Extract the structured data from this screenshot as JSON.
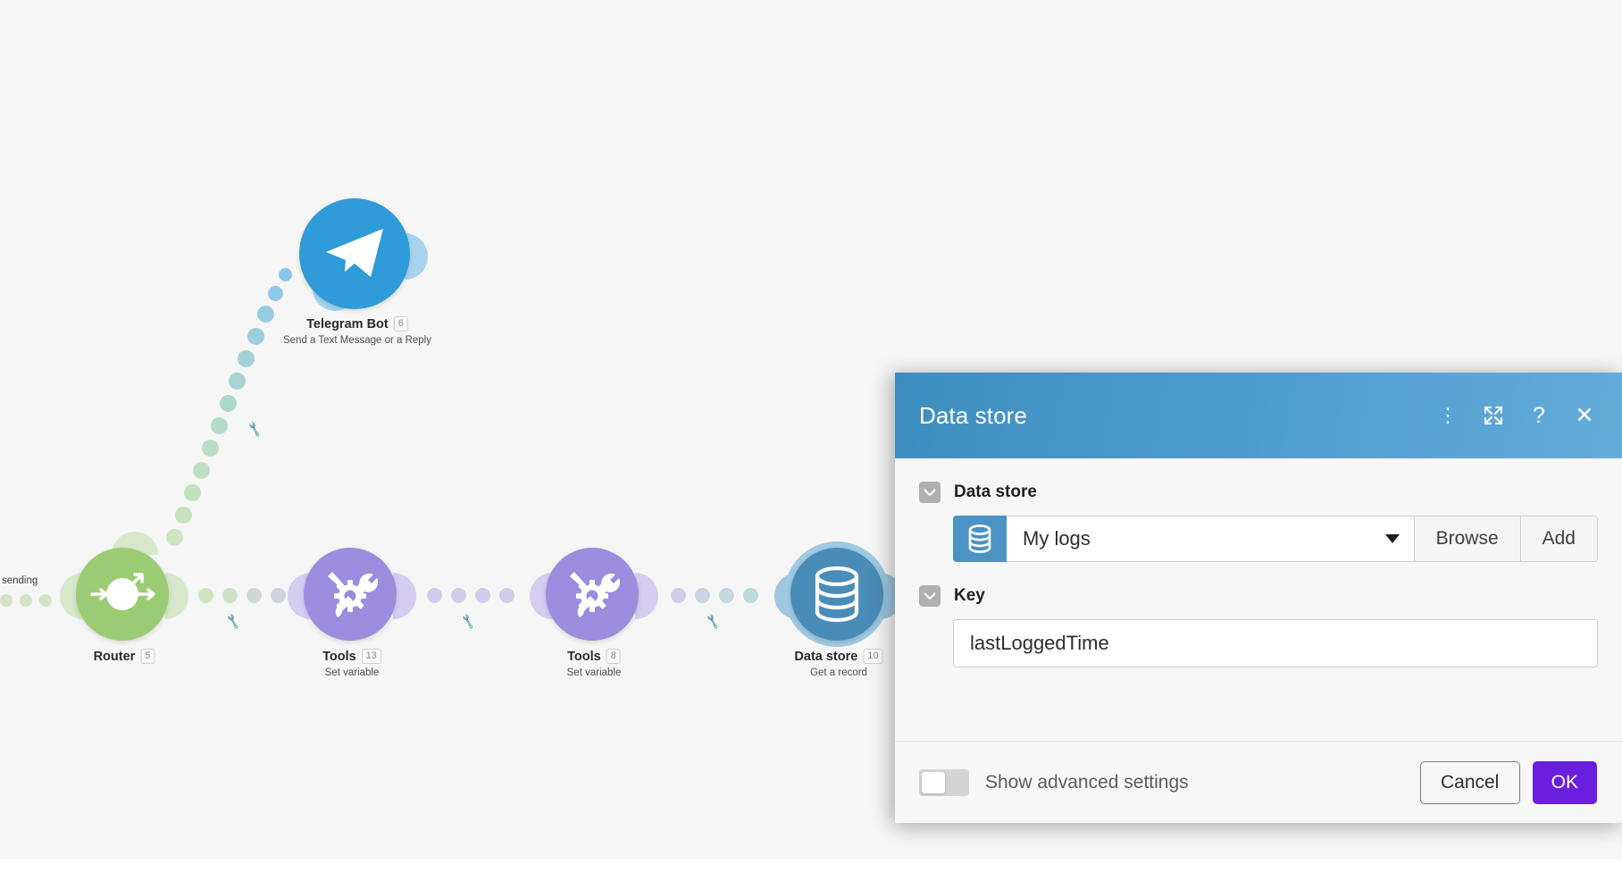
{
  "canvas": {
    "route_label": "sending",
    "nodes": [
      {
        "id": "telegram",
        "title": "Telegram Bot",
        "badge": "6",
        "subtitle": "Send a Text Message or a Reply",
        "color": "#2f9bd8",
        "icon": "telegram-icon"
      },
      {
        "id": "router",
        "title": "Router",
        "badge": "5",
        "subtitle": "",
        "color": "#9ccb75",
        "icon": "router-icon"
      },
      {
        "id": "tools-13",
        "title": "Tools",
        "badge": "13",
        "subtitle": "Set variable",
        "color": "#9b8cdd",
        "icon": "tools-icon"
      },
      {
        "id": "tools-8",
        "title": "Tools",
        "badge": "8",
        "subtitle": "Set variable",
        "color": "#9b8cdd",
        "icon": "tools-icon"
      },
      {
        "id": "datastore-10",
        "title": "Data store",
        "badge": "10",
        "subtitle": "Get a record",
        "color": "#4a8cb8",
        "icon": "database-icon"
      }
    ]
  },
  "modal": {
    "title": "Data store",
    "header_icons": [
      {
        "name": "more-options-icon",
        "glyph": "⋮"
      },
      {
        "name": "expand-icon",
        "glyph": "expand"
      },
      {
        "name": "help-icon",
        "glyph": "?"
      },
      {
        "name": "close-icon",
        "glyph": "✕"
      }
    ],
    "fields": {
      "datastore": {
        "label": "Data store",
        "value": "My logs",
        "icon": "database-icon",
        "browse_label": "Browse",
        "add_label": "Add"
      },
      "key": {
        "label": "Key",
        "value": "lastLoggedTime",
        "placeholder": ""
      }
    },
    "footer": {
      "advanced_label": "Show advanced settings",
      "advanced_on": false,
      "cancel_label": "Cancel",
      "ok_label": "OK"
    },
    "colors": {
      "header_start": "#3d8ec0",
      "header_end": "#63abd9",
      "ok_button": "#6a1ee0",
      "select_icon": "#4a93c4"
    }
  }
}
